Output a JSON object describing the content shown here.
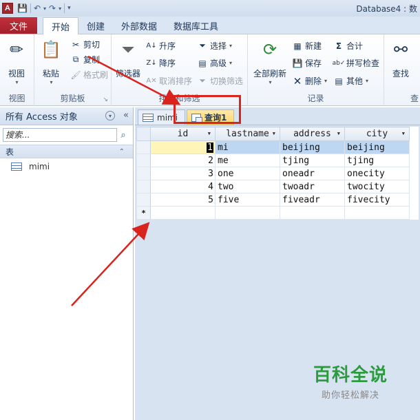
{
  "titlebar": {
    "app_icon": "A",
    "title": "Database4 : 数"
  },
  "tabs": {
    "file": "文件",
    "items": [
      "开始",
      "创建",
      "外部数据",
      "数据库工具"
    ],
    "active_index": 0
  },
  "ribbon": {
    "view": {
      "button": "视图",
      "group": "视图"
    },
    "clipboard": {
      "paste": "粘贴",
      "cut": "剪切",
      "copy": "复制",
      "format_painter": "格式刷",
      "group": "剪贴板"
    },
    "sort_filter": {
      "filter": "筛选器",
      "ascending": "升序",
      "descending": "降序",
      "clear_sort": "取消排序",
      "selection": "选择",
      "advanced": "高级",
      "toggle_filter": "切换筛选",
      "group": "排序和筛选"
    },
    "records": {
      "refresh_all": "全部刷新",
      "new": "新建",
      "save": "保存",
      "delete": "删除",
      "totals": "合计",
      "spelling": "拼写检查",
      "more": "其他",
      "group": "记录"
    },
    "find": {
      "button": "查找",
      "group": "查"
    }
  },
  "navpane": {
    "header": "所有 Access 对象",
    "search_placeholder": "搜索...",
    "section": "表",
    "items": [
      "mimi"
    ]
  },
  "doc_tabs": [
    {
      "label": "mimi",
      "active": false
    },
    {
      "label": "查询1",
      "active": true
    }
  ],
  "grid": {
    "columns": [
      "id",
      "lastname",
      "address",
      "city"
    ],
    "rows": [
      [
        "1",
        "mi",
        "beijing",
        "beijing"
      ],
      [
        "2",
        "me",
        "tjing",
        "tjing"
      ],
      [
        "3",
        "one",
        "oneadr",
        "onecity"
      ],
      [
        "4",
        "two",
        "twoadr",
        "twocity"
      ],
      [
        "5",
        "five",
        "fiveadr",
        "fivecity"
      ]
    ],
    "new_row_marker": "*"
  },
  "watermark": {
    "main": "百科全说",
    "sub": "助你轻松解决"
  },
  "colors": {
    "file_tab": "#a3202a",
    "annotation": "#d9231c",
    "active_doc_tab": "#ffd36a",
    "selected_row": "#bdd6f2",
    "watermark": "#2c9a3e"
  }
}
